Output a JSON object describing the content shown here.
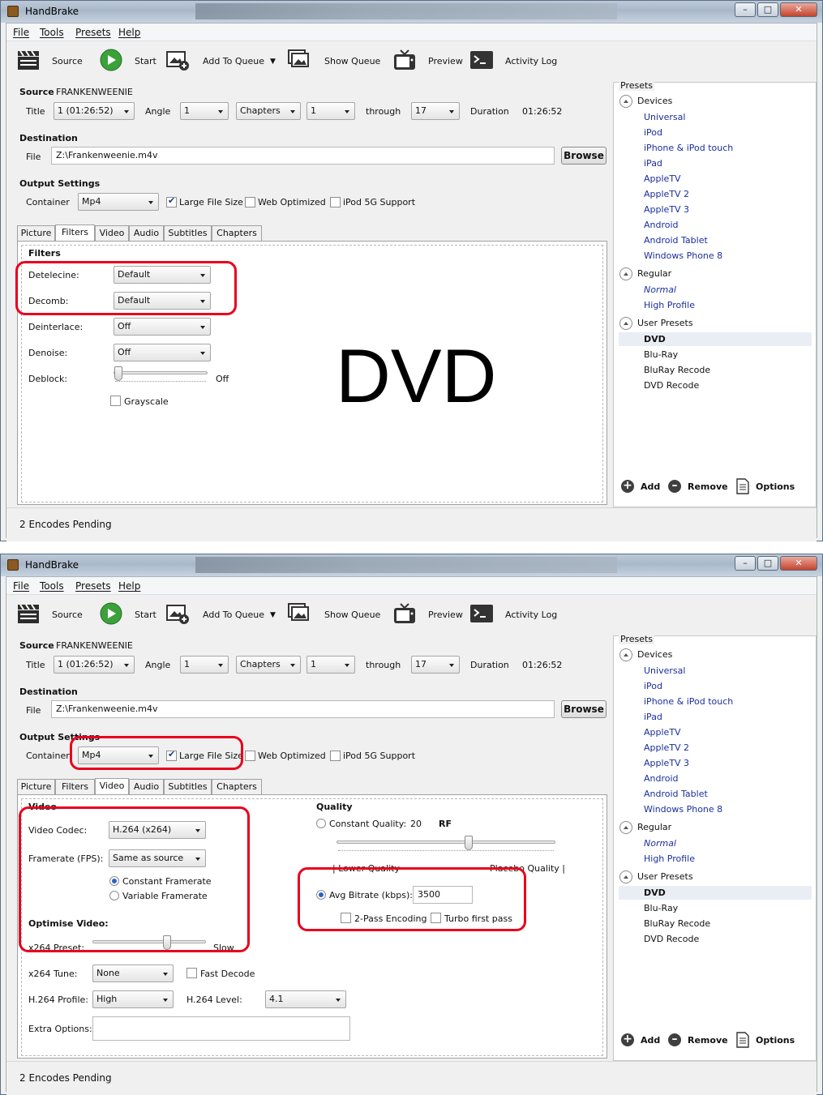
{
  "app": {
    "title": "HandBrake"
  },
  "menu": [
    "File",
    "Tools",
    "Presets",
    "Help"
  ],
  "toolbar": {
    "source": "Source",
    "start": "Start",
    "add_to_queue": "Add To Queue",
    "show_queue": "Show Queue",
    "preview": "Preview",
    "activity_log": "Activity Log"
  },
  "source": {
    "label": "Source",
    "name": "FRANKENWEENIE",
    "title_label": "Title",
    "title_value": "1 (01:26:52)",
    "angle_label": "Angle",
    "angle_value": "1",
    "range_type": "Chapters",
    "range_start": "1",
    "through_label": "through",
    "range_end": "17",
    "duration_label": "Duration",
    "duration_value": "01:26:52"
  },
  "destination": {
    "label": "Destination",
    "file_label": "File",
    "file_value": "Z:\\Frankenweenie.m4v",
    "browse": "Browse"
  },
  "output": {
    "label": "Output Settings",
    "container_label": "Container",
    "container_value": "Mp4",
    "large_file": "Large File Size",
    "web_optimized": "Web Optimized",
    "ipod_5g": "iPod 5G Support"
  },
  "tabs": [
    "Picture",
    "Filters",
    "Video",
    "Audio",
    "Subtitles",
    "Chapters"
  ],
  "filters": {
    "heading": "Filters",
    "detelecine_label": "Detelecine:",
    "detelecine_value": "Default",
    "decomb_label": "Decomb:",
    "decomb_value": "Default",
    "deinterlace_label": "Deinterlace:",
    "deinterlace_value": "Off",
    "denoise_label": "Denoise:",
    "denoise_value": "Off",
    "deblock_label": "Deblock:",
    "deblock_value": "Off",
    "grayscale": "Grayscale",
    "overlay": "DVD"
  },
  "video": {
    "heading": "Video",
    "codec_label": "Video Codec:",
    "codec_value": "H.264 (x264)",
    "fps_label": "Framerate (FPS):",
    "fps_value": "Same as source",
    "constant_fr": "Constant Framerate",
    "variable_fr": "Variable Framerate",
    "optimise_heading": "Optimise Video:",
    "preset_label": "x264 Preset:",
    "preset_value": "Slow",
    "tune_label": "x264 Tune:",
    "tune_value": "None",
    "fast_decode": "Fast Decode",
    "profile_label": "H.264 Profile:",
    "profile_value": "High",
    "level_label": "H.264 Level:",
    "level_value": "4.1",
    "extra_label": "Extra Options:",
    "quality_heading": "Quality",
    "cq_label": "Constant Quality:",
    "cq_value": "20",
    "cq_unit": "RF",
    "lower_quality": "| Lower Quality",
    "placebo_quality": "Placebo Quality |",
    "bitrate_label": "Avg Bitrate (kbps):",
    "bitrate_value": "3500",
    "two_pass": "2-Pass Encoding",
    "turbo": "Turbo first pass"
  },
  "presets": {
    "heading": "Presets",
    "groups": [
      {
        "name": "Devices",
        "items": [
          "Universal",
          "iPod",
          "iPhone & iPod touch",
          "iPad",
          "AppleTV",
          "AppleTV 2",
          "AppleTV 3",
          "Android",
          "Android Tablet",
          "Windows Phone 8"
        ]
      },
      {
        "name": "Regular",
        "items": [
          "Normal",
          "High Profile"
        ]
      },
      {
        "name": "User Presets",
        "items": [
          "DVD",
          "Blu-Ray",
          "BluRay Recode",
          "DVD Recode"
        ]
      }
    ],
    "add": "Add",
    "remove": "Remove",
    "options": "Options"
  },
  "status": {
    "text": "2 Encodes Pending"
  },
  "colors": {
    "highlight_box": "#e8001c",
    "preset_link": "#1a2f9e"
  }
}
